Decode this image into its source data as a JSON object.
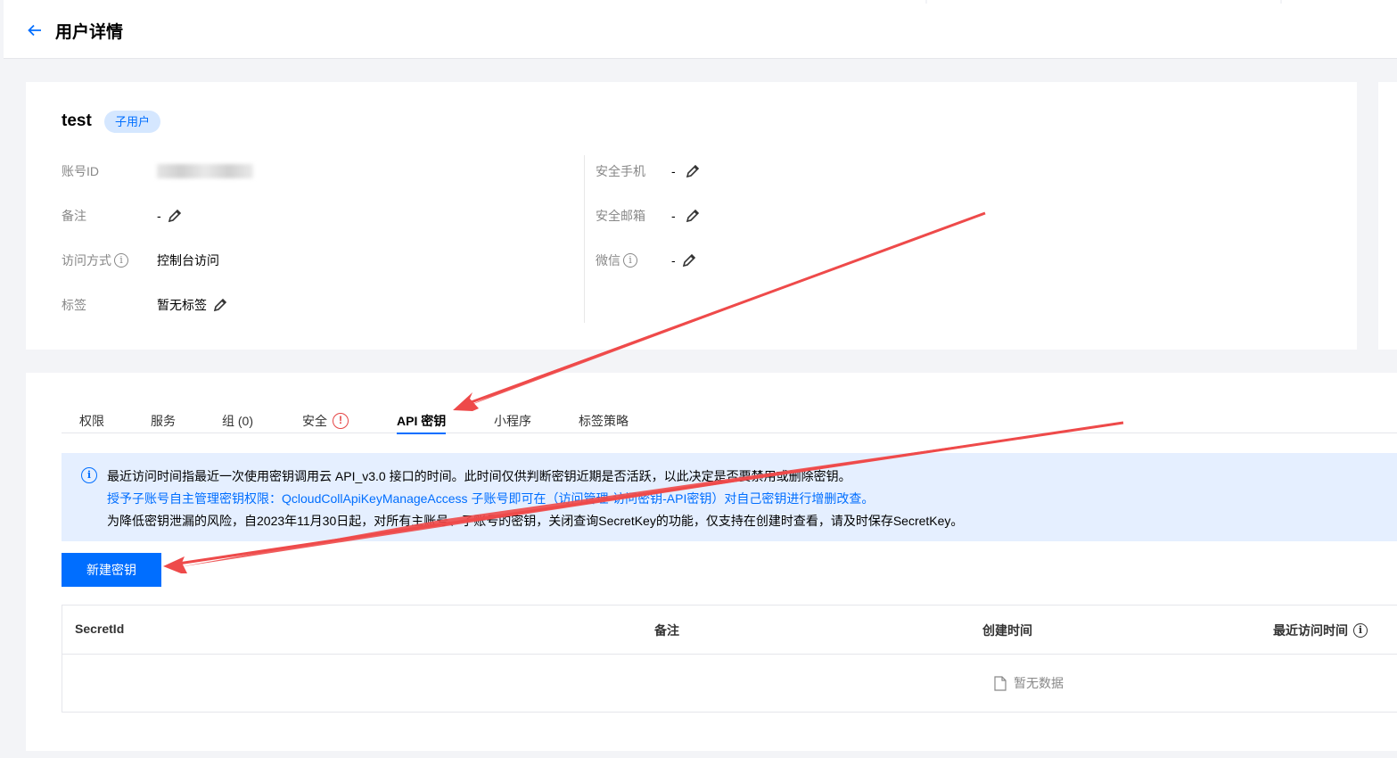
{
  "header": {
    "back_icon": "arrow-left-icon",
    "title": "用户详情"
  },
  "user": {
    "name": "test",
    "badge": "子用户"
  },
  "fields_left": [
    {
      "label": "账号ID",
      "value": "",
      "info": false,
      "editable": false
    },
    {
      "label": "备注",
      "value": "-",
      "info": false,
      "editable": true
    },
    {
      "label": "访问方式",
      "value": "控制台访问",
      "info": true,
      "editable": false
    },
    {
      "label": "标签",
      "value": "暂无标签",
      "info": false,
      "editable": true
    }
  ],
  "fields_right": [
    {
      "label": "安全手机",
      "value": "-",
      "info": false,
      "editable": true
    },
    {
      "label": "安全邮箱",
      "value": "-",
      "info": false,
      "editable": true
    },
    {
      "label": "微信",
      "value": "-",
      "info": true,
      "editable": true
    }
  ],
  "tabs": [
    {
      "label": "权限"
    },
    {
      "label": "服务"
    },
    {
      "label": "组 (0)"
    },
    {
      "label": "安全"
    },
    {
      "label": "API 密钥"
    },
    {
      "label": "小程序"
    },
    {
      "label": "标签策略"
    }
  ],
  "active_tab": "API 密钥",
  "alert": {
    "line1": "最近访问时间指最近一次使用密钥调用云 API_v3.0 接口的时间。此时间仅供判断密钥近期是否活跃，以此决定是否要禁用或删除密钥。",
    "line2": "授予子账号自主管理密钥权限：QcloudCollApiKeyManageAccess 子账号即可在（访问管理-访问密钥-API密钥）对自己密钥进行增删改查。",
    "line3": "为降低密钥泄漏的风险，自2023年11月30日起，对所有主账号、子账号的密钥，关闭查询SecretKey的功能，仅支持在创建时查看，请及时保存SecretKey。"
  },
  "new_key_button": "新建密钥",
  "table": {
    "columns": [
      "SecretId",
      "备注",
      "创建时间",
      "最近访问时间"
    ],
    "empty_text": "暂无数据"
  },
  "colors": {
    "accent": "#006eff",
    "badge_bg": "#d5e7ff",
    "alert_bg": "#e5efff",
    "warning": "#e54545",
    "annotation_arrow": "#ee4a4a"
  }
}
